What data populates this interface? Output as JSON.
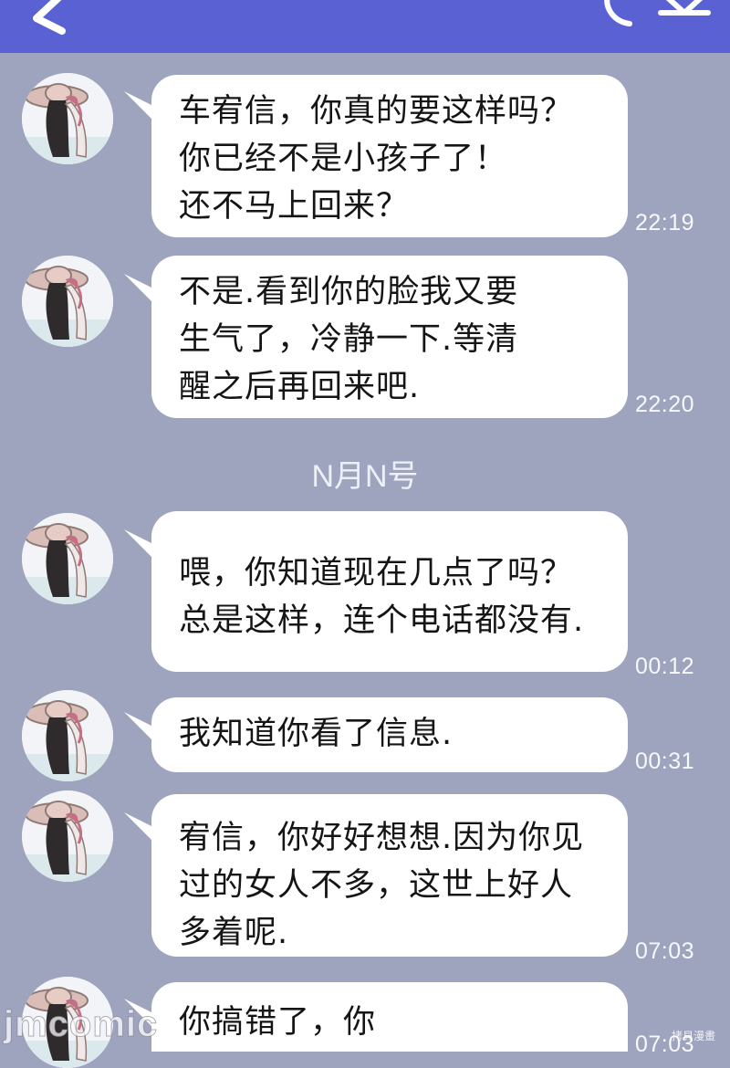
{
  "header": {
    "back_icon": "chevron-left-icon",
    "call_icon": "phone-icon",
    "menu_icon": "chevron-down-icon",
    "color": "#5a62d3"
  },
  "background_color": "#9ea4be",
  "date_divider": "N月N号",
  "messages": [
    {
      "lines": [
        "车宥信，你真的要这样吗？",
        "你已经不是小孩子了！",
        "还不马上回来？"
      ],
      "time": "22:19"
    },
    {
      "lines": [
        "不是.看到你的脸我又要",
        "生气了，冷静一下.等清",
        "醒之后再回来吧."
      ],
      "time": "22:20"
    },
    {
      "lines": [
        "喂，你知道现在几点了吗？",
        "总是这样，连个电话都没有."
      ],
      "time": "00:12"
    },
    {
      "lines": [
        "我知道你看了信息."
      ],
      "time": "00:31"
    },
    {
      "lines": [
        "宥信，你好好想想.因为你见",
        "过的女人不多，这世上好人",
        "多着呢."
      ],
      "time": "07:03"
    },
    {
      "lines": [
        "你搞错了，你"
      ],
      "time": "07:03"
    }
  ],
  "watermark": "jmcomic",
  "corner_watermark": "拷貝漫畫"
}
